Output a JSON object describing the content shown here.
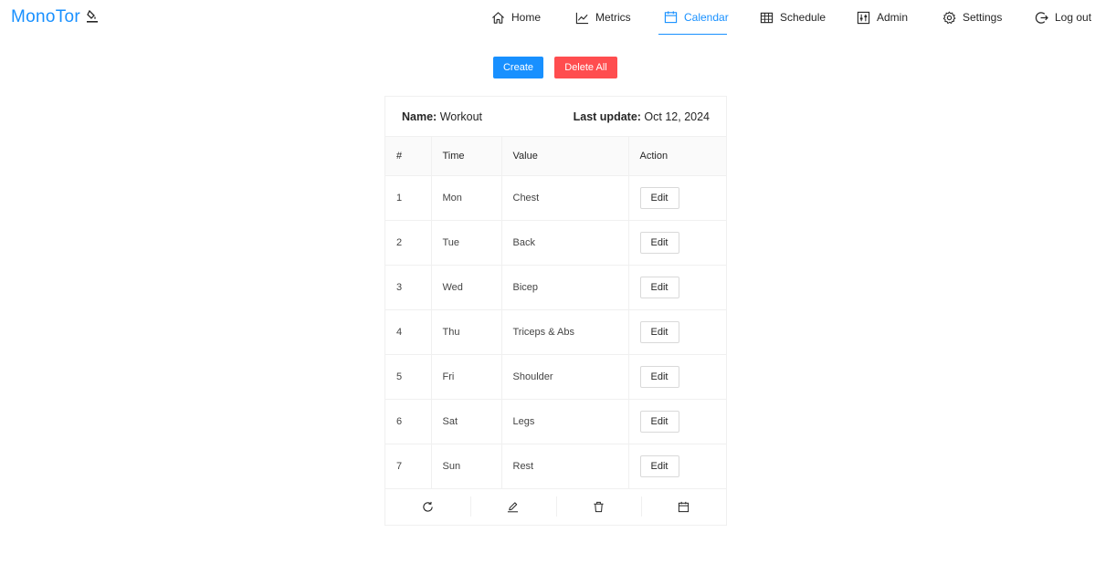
{
  "app": {
    "brand": "MonoTor"
  },
  "nav": {
    "items": [
      {
        "label": "Home",
        "icon": "home-icon"
      },
      {
        "label": "Metrics",
        "icon": "line-chart-icon"
      },
      {
        "label": "Calendar",
        "icon": "calendar-icon",
        "active": true
      },
      {
        "label": "Schedule",
        "icon": "table-icon"
      },
      {
        "label": "Admin",
        "icon": "sliders-icon"
      },
      {
        "label": "Settings",
        "icon": "gear-icon"
      },
      {
        "label": "Log out",
        "icon": "logout-icon"
      }
    ]
  },
  "toolbar": {
    "create_label": "Create",
    "delete_all_label": "Delete All"
  },
  "card": {
    "name_label": "Name:",
    "name_value": "Workout",
    "update_label": "Last update:",
    "update_value": "Oct 12, 2024"
  },
  "table": {
    "columns": [
      "#",
      "Time",
      "Value",
      "Action"
    ],
    "edit_label": "Edit",
    "rows": [
      {
        "num": "1",
        "time": "Mon",
        "value": "Chest"
      },
      {
        "num": "2",
        "time": "Tue",
        "value": "Back"
      },
      {
        "num": "3",
        "time": "Wed",
        "value": "Bicep"
      },
      {
        "num": "4",
        "time": "Thu",
        "value": "Triceps & Abs"
      },
      {
        "num": "5",
        "time": "Fri",
        "value": "Shoulder"
      },
      {
        "num": "6",
        "time": "Sat",
        "value": "Legs"
      },
      {
        "num": "7",
        "time": "Sun",
        "value": "Rest"
      }
    ]
  },
  "card_actions": [
    "reload-icon",
    "edit-icon",
    "delete-icon",
    "calendar-icon"
  ],
  "colors": {
    "primary": "#1890ff",
    "danger": "#ff4d4f",
    "border": "#f0f0f0"
  }
}
